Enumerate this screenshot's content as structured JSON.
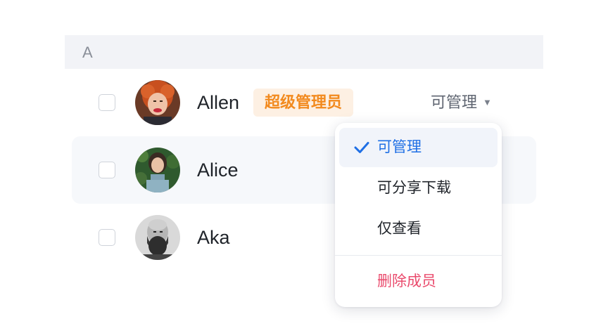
{
  "section": {
    "letter": "A"
  },
  "members": [
    {
      "name": "Allen",
      "badge": "超级管理员",
      "permission": "可管理"
    },
    {
      "name": "Alice"
    },
    {
      "name": "Aka"
    }
  ],
  "dropdown": {
    "items": [
      {
        "label": "可管理",
        "selected": true
      },
      {
        "label": "可分享下载",
        "selected": false
      },
      {
        "label": "仅查看",
        "selected": false
      }
    ],
    "danger_item": {
      "label": "删除成员"
    }
  },
  "colors": {
    "accent": "#1f6fe5",
    "badge_text": "#f28a1e",
    "badge_bg": "#fdf0e3",
    "danger": "#ea4b6d",
    "header_bg": "#f2f3f7",
    "row_hover_bg": "#f6f8fb"
  },
  "icons": {
    "caret": "caret-down-icon",
    "check": "checkmark-icon"
  }
}
